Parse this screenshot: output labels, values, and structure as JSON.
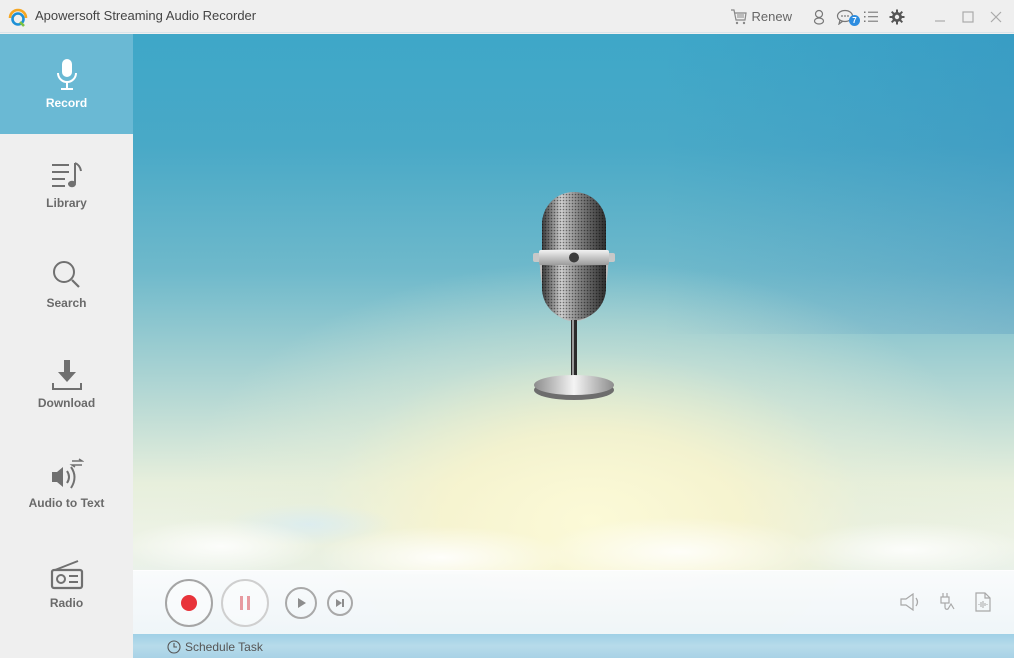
{
  "app": {
    "title": "Apowersoft Streaming Audio Recorder",
    "logo_icon": "apowersoft-logo-icon"
  },
  "titlebar": {
    "renew_label": "Renew",
    "renew_icon": "cart-icon",
    "account_icon": "user-icon",
    "messages_icon": "chat-icon",
    "messages_badge": "7",
    "menu_icon": "list-menu-icon",
    "settings_icon": "gear-icon",
    "minimize_icon": "minimize-icon",
    "maximize_icon": "maximize-icon",
    "close_icon": "close-icon"
  },
  "sidebar": {
    "items": [
      {
        "label": "Record",
        "icon": "microphone-icon",
        "active": true
      },
      {
        "label": "Library",
        "icon": "music-list-icon",
        "active": false
      },
      {
        "label": "Search",
        "icon": "search-icon",
        "active": false
      },
      {
        "label": "Download",
        "icon": "download-icon",
        "active": false
      },
      {
        "label": "Audio to Text",
        "icon": "speaker-convert-icon",
        "active": false
      },
      {
        "label": "Radio",
        "icon": "radio-icon",
        "active": false
      }
    ]
  },
  "controls": {
    "record_icon": "record-icon",
    "pause_icon": "pause-icon",
    "play_icon": "play-icon",
    "skip_icon": "skip-next-icon",
    "volume_icon": "speaker-icon",
    "audio_source_icon": "audio-input-icon",
    "output_format_icon": "audio-file-icon"
  },
  "schedule": {
    "label": "Schedule Task",
    "icon": "clock-icon"
  },
  "colors": {
    "active_nav": "#6ab9d4",
    "record_red": "#e8333a",
    "pause_pink": "#e79aa0",
    "badge_blue": "#2d8de0"
  }
}
